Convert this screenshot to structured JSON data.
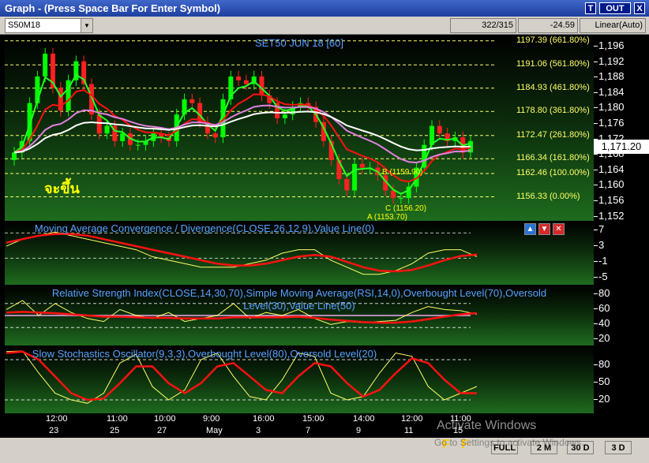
{
  "window": {
    "title": "Graph  - (Press Space Bar For Enter Symbol)",
    "btn_t": "T",
    "btn_out": "OUT",
    "btn_x": "X"
  },
  "toolbar": {
    "symbol": "S50M18",
    "count": "322/315",
    "change": "-24.59",
    "scale": "Linear(Auto)"
  },
  "price_pane": {
    "title": "SET50 JUN 18   [60]",
    "thai_label": "จะขึ้น",
    "fib_levels": [
      "1197.39 (661.80%)",
      "1191.06 (561.80%)",
      "1184.93 (461.80%)",
      "1178.80 (361.80%)",
      "1172.47 (261.80%)",
      "1166.34 (161.80%)",
      "1162.46 (100.00%)",
      "1156.33 (0.00%)"
    ],
    "annotations": {
      "b": "B (1159.90)",
      "c": "C (1156.20)",
      "a": "A (1153.70)"
    },
    "y_ticks": [
      "1,196",
      "1,192",
      "1,188",
      "1,184",
      "1,180",
      "1,176",
      "1,172",
      "1,168",
      "1,164",
      "1,160",
      "1,156",
      "1,152"
    ],
    "last_price": "1,171.20",
    "colors": {
      "candle_up": "#00ff00",
      "candle_down": "#ff2020",
      "ma_fast": "#22ff22",
      "ma_mid": "#ff1010",
      "ma_slow": "#e080e0",
      "ma_long": "#ffffff",
      "fib": "#ffff66"
    },
    "close": [
      1168,
      1171,
      1181,
      1188,
      1194,
      1185,
      1179,
      1187,
      1192,
      1186,
      1178,
      1173,
      1175,
      1171,
      1173,
      1170,
      1170,
      1171,
      1173,
      1172,
      1171,
      1178,
      1182,
      1181,
      1176,
      1173,
      1172,
      1182,
      1188,
      1187,
      1186,
      1188,
      1183,
      1181,
      1177,
      1178,
      1180,
      1181,
      1180,
      1176,
      1171,
      1166,
      1161,
      1158,
      1165,
      1164,
      1164,
      1162,
      1158,
      1156,
      1156,
      1159,
      1164,
      1170,
      1175,
      1173,
      1171,
      1172,
      1168,
      1171
    ]
  },
  "macd_pane": {
    "title": "Moving Average Convergence / Divergence(CLOSE,26,12,9),Value Line(0)",
    "y_ticks": [
      "7",
      "3",
      "-1",
      "-5"
    ],
    "macd": [
      3,
      5,
      6,
      7,
      6,
      5,
      4,
      3,
      2,
      0,
      -1,
      -2,
      -3,
      -3,
      -3,
      -2,
      -1,
      1,
      2,
      2,
      -1,
      -3,
      -5,
      -5,
      -4,
      -2,
      1,
      2,
      2,
      0
    ],
    "signal": [
      4,
      5,
      6,
      6.5,
      6.5,
      6,
      5,
      4,
      3,
      2,
      1,
      0,
      -1,
      -2,
      -2.5,
      -2.5,
      -2,
      -1,
      0,
      0.5,
      0,
      -1.5,
      -3,
      -4,
      -4.2,
      -3.8,
      -2.5,
      -1,
      0.2,
      0.6
    ]
  },
  "rsi_pane": {
    "title": "Relative Strength Index(CLOSE,14,30,70),Simple Moving Average(RSI,14,0),Overbought Level(70),Oversold Level(30),Value Line(50)",
    "y_ticks": [
      "80",
      "60",
      "40",
      "20"
    ],
    "rsi": [
      60,
      75,
      50,
      70,
      55,
      45,
      40,
      60,
      50,
      45,
      55,
      40,
      45,
      50,
      70,
      45,
      55,
      50,
      60,
      45,
      35,
      40,
      38,
      40,
      42,
      55,
      65,
      60,
      58,
      52
    ],
    "sma": [
      55,
      56,
      55,
      54,
      52,
      50,
      48,
      48,
      47,
      46,
      46,
      45,
      45,
      45,
      47,
      47,
      47,
      47,
      48,
      46,
      43,
      41,
      39,
      38,
      38,
      40,
      44,
      48,
      52,
      54
    ]
  },
  "stoch_pane": {
    "title": "Slow Stochastics Oscillator(9,3,3),Overbought Level(80),Oversold Level(20)",
    "y_ticks": [
      "80",
      "50",
      "20"
    ],
    "k": [
      92,
      93,
      60,
      30,
      20,
      15,
      30,
      75,
      88,
      40,
      20,
      35,
      80,
      90,
      55,
      25,
      20,
      50,
      90,
      85,
      30,
      20,
      25,
      60,
      90,
      85,
      40,
      20,
      30,
      40
    ],
    "d": [
      90,
      92,
      80,
      55,
      30,
      20,
      22,
      45,
      70,
      70,
      45,
      30,
      45,
      70,
      75,
      55,
      35,
      30,
      55,
      75,
      70,
      45,
      25,
      35,
      60,
      82,
      75,
      50,
      30,
      30
    ]
  },
  "xaxis": {
    "times": [
      "12:00",
      "11:00",
      "10:00",
      "9:00",
      "16:00",
      "15:00",
      "14:00",
      "12:00",
      "11:00"
    ],
    "dates": [
      "23",
      "25",
      "27",
      "May",
      "3",
      "7",
      "9",
      "11",
      "15"
    ]
  },
  "statusbar": {
    "full": "FULL",
    "m2": "2 M",
    "d30": "30 D",
    "d3": "3 D",
    "ff1": "F",
    "ff2": "F"
  },
  "watermark": {
    "line1": "Activate Windows",
    "line2": "Go to Settings to activate Windows."
  }
}
